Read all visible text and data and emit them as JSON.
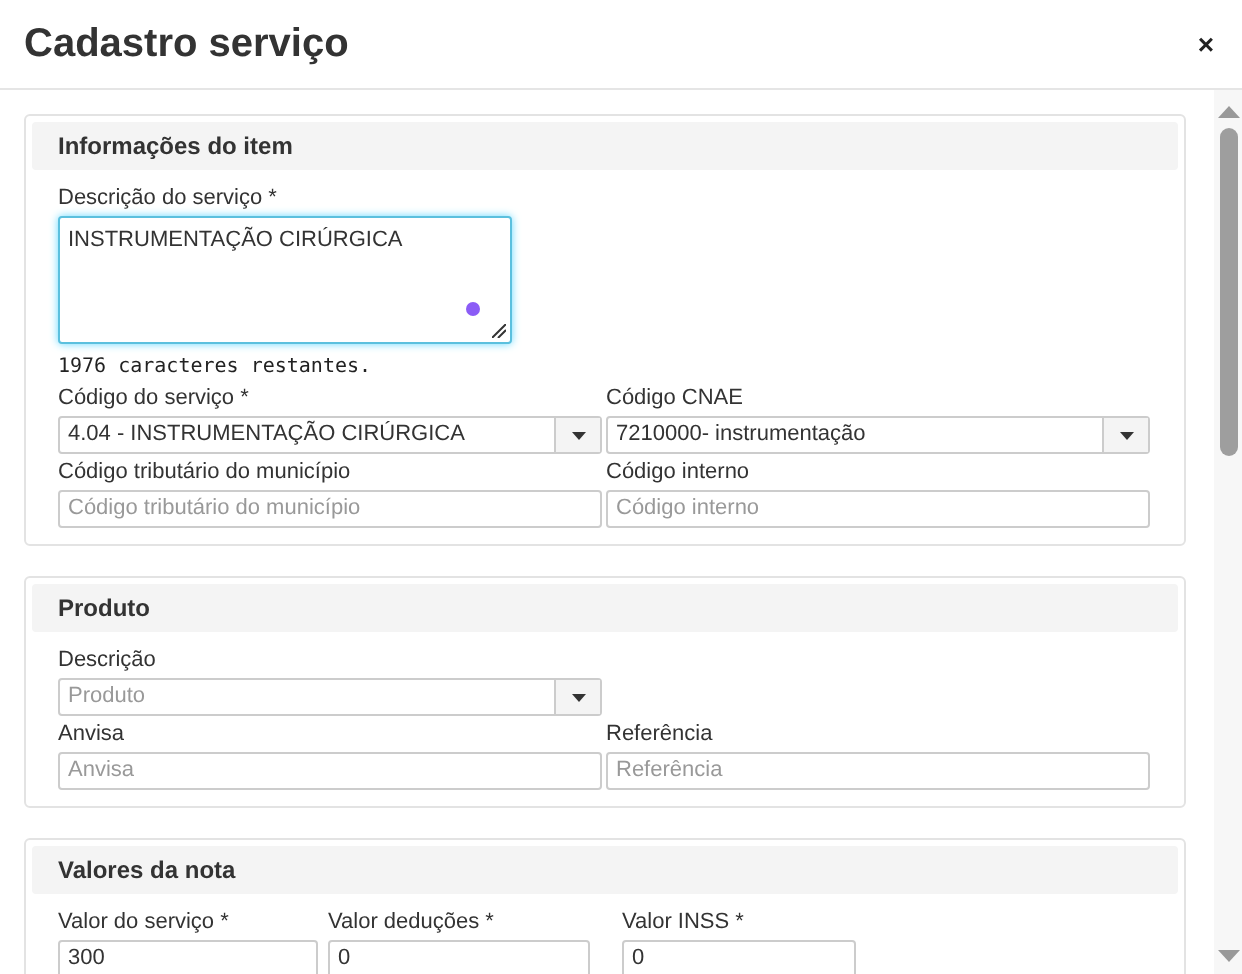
{
  "dialog": {
    "title": "Cadastro serviço",
    "close": "×"
  },
  "sections": [
    {
      "title": "Informações do item",
      "rows": [
        [
          {
            "kind": "textarea",
            "label": "Descrição do serviço *",
            "value": "INSTRUMENTAÇÃO CIRÚRGICA",
            "focused": true,
            "counter": "1976 caracteres restantes."
          }
        ],
        [
          {
            "kind": "select",
            "label": "Código do serviço *",
            "value": "4.04 - INSTRUMENTAÇÃO CIRÚRGICA"
          },
          {
            "kind": "select",
            "label": "Código CNAE",
            "value": "7210000- instrumentação"
          }
        ],
        [
          {
            "kind": "input",
            "label": "Código tributário do município",
            "placeholder": "Código tributário do município"
          },
          {
            "kind": "input",
            "label": "Código interno",
            "placeholder": "Código interno"
          }
        ]
      ]
    },
    {
      "title": "Produto",
      "rows": [
        [
          {
            "kind": "select",
            "label": "Descrição",
            "placeholder": "Produto"
          }
        ],
        [
          {
            "kind": "input",
            "label": "Anvisa",
            "placeholder": "Anvisa"
          },
          {
            "kind": "input",
            "label": "Referência",
            "placeholder": "Referência"
          }
        ]
      ]
    },
    {
      "title": "Valores da nota",
      "rows": [
        [
          {
            "kind": "input",
            "label": "Valor do serviço *",
            "value": "300"
          },
          {
            "kind": "input",
            "label": "Valor deduções *",
            "value": "0"
          },
          {
            "kind": "input",
            "label": "Valor INSS *",
            "value": "0"
          }
        ]
      ]
    }
  ]
}
